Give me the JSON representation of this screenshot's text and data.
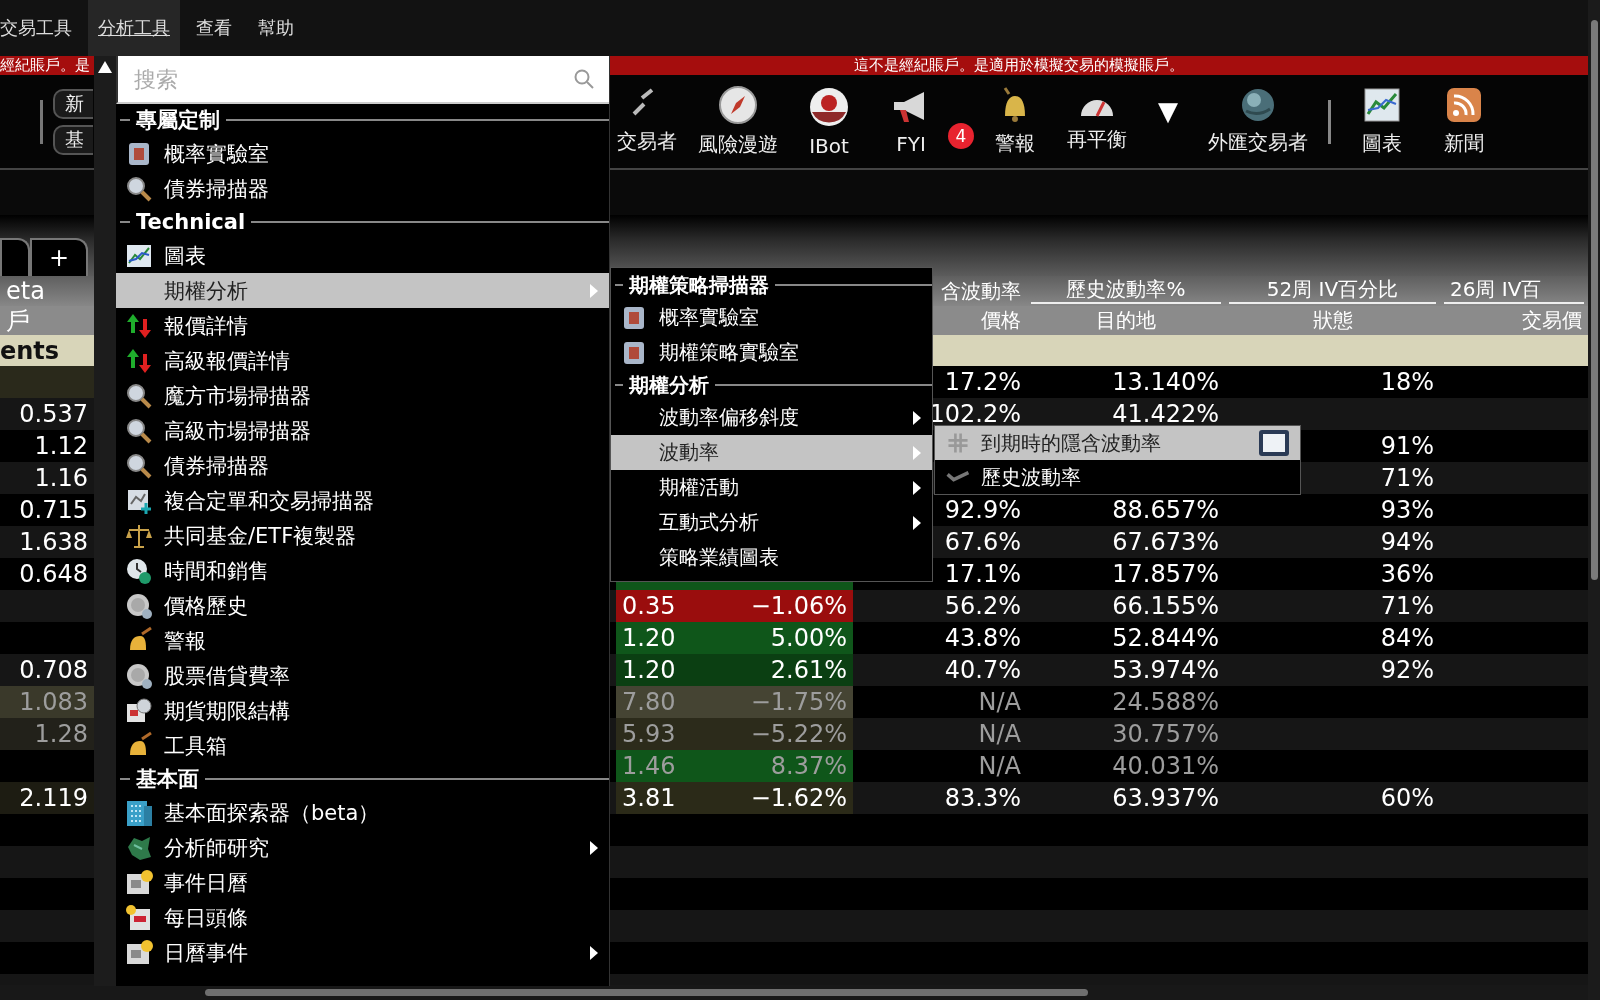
{
  "menu_bar": [
    {
      "label": "交易工具",
      "selected": false
    },
    {
      "label": "分析工具",
      "selected": true
    },
    {
      "label": "查看",
      "selected": false
    },
    {
      "label": "幫助",
      "selected": false
    }
  ],
  "banner": {
    "left_text": "經紀賬戶。是",
    "text": "這不是經紀賬戶。是適用於模擬交易的模擬賬戶。"
  },
  "side_buttons": [
    "新",
    "基"
  ],
  "toolbar": [
    {
      "label": "交易者",
      "kind": "chain"
    },
    {
      "label": "風險漫遊",
      "kind": "compass"
    },
    {
      "label": "IBot",
      "kind": "bot"
    },
    {
      "label": "FYI",
      "kind": "megaphone",
      "badge": "4"
    },
    {
      "label": "警報",
      "kind": "bell"
    },
    {
      "label": "再平衡",
      "kind": "gauge"
    },
    {
      "label": "▼",
      "kind": "dropdown"
    },
    {
      "label": "外匯交易者",
      "kind": "fx"
    },
    {
      "kind": "separator"
    },
    {
      "label": "圖表",
      "kind": "chart"
    },
    {
      "label": "新聞",
      "kind": "rss"
    }
  ],
  "side_tabs": [
    {
      "selected": false
    },
    {
      "label": "+",
      "selected": false
    }
  ],
  "table": {
    "header_left": [
      "eta",
      "戶",
      "ents"
    ],
    "columns_row_1": {
      "column_3": "含波動率",
      "column_4": "歷史波動率%",
      "column_5": "52周 IV百分比",
      "column_6": "26周 IV百"
    },
    "columns_row_2": {
      "column_3": "價格",
      "column_4": "目的地",
      "column_5": "狀態",
      "column_6": "交易價"
    },
    "rows": [
      {
        "column_0": {
          "color": "#2a291b"
        },
        "column_3": "17.2%",
        "column_4": "13.140%",
        "column_5": "18%",
        "dim": false
      },
      {
        "column_0": "0.537",
        "column_3": "102.2%",
        "column_4": "41.422%",
        "dim": false
      },
      {
        "column_0": "1.12",
        "column_5": "91%",
        "dim": false
      },
      {
        "column_0": "1.16",
        "column_5": "71%",
        "dim": false
      },
      {
        "column_0": "0.715",
        "column_3": "92.9%",
        "column_4": "88.657%",
        "column_5": "93%",
        "dim": false
      },
      {
        "column_0": "1.638",
        "column_3": "67.6%",
        "column_4": "67.673%",
        "column_5": "94%",
        "dim": false
      },
      {
        "column_0": "0.648",
        "column_1": {
          "color": "#0f561a"
        },
        "column_2": {
          "color": "#0f561a"
        },
        "column_3": "17.1%",
        "column_4": "17.857%",
        "column_5": "36%",
        "dim": false
      },
      {
        "column_1": {
          "text": "0.35",
          "color": "#9a0d0d"
        },
        "column_2": {
          "text": "−1.06%",
          "color": "#9a0d0d"
        },
        "column_3": "56.2%",
        "column_4": "66.155%",
        "column_5": "71%",
        "dim": false
      },
      {
        "column_1": {
          "text": "1.20",
          "color": "#0f561a"
        },
        "column_2": {
          "text": "5.00%",
          "color": "#0f561a"
        },
        "column_3": "43.8%",
        "column_4": "52.844%",
        "column_5": "84%",
        "dim": false
      },
      {
        "column_0": "0.708",
        "column_1": {
          "text": "1.20",
          "color": "#0b3f12"
        },
        "column_2": {
          "text": "2.61%",
          "color": "#0b3f12"
        },
        "column_3": "40.7%",
        "column_4": "53.974%",
        "column_5": "92%",
        "dim": false
      },
      {
        "column_0": {
          "text": "1.083",
          "color": "#3a392a"
        },
        "column_1": {
          "text": "7.80",
          "color": "#454433"
        },
        "column_2": {
          "text": "−1.75%",
          "color": "#454433"
        },
        "column_3": "N/A",
        "column_4": "24.588%",
        "dim": true
      },
      {
        "column_0": {
          "text": "1.28",
          "color": "#22211a"
        },
        "column_1": {
          "text": "5.93",
          "color": "#2c2b1b"
        },
        "column_2": {
          "text": "−5.22%",
          "color": "#2c2b1b"
        },
        "column_3": "N/A",
        "column_4": "30.757%",
        "dim": true
      },
      {
        "column_1": {
          "text": "1.46",
          "color": "#0f561a"
        },
        "column_2": {
          "text": "8.37%",
          "color": "#0f561a"
        },
        "column_3": "N/A",
        "column_4": "40.031%",
        "dim": true
      },
      {
        "column_0": {
          "text": "2.119",
          "color": "#1d1c12"
        },
        "column_1": {
          "text": "3.81",
          "color": "#2b2a18"
        },
        "column_2": {
          "text": "−1.62%",
          "color": "#2b2a18"
        },
        "column_3": "83.3%",
        "column_4": "63.937%",
        "column_5": "60%",
        "dim": false
      }
    ]
  },
  "dropdown": {
    "search": {
      "placeholder": "搜索"
    },
    "sections": [
      {
        "title": "專屬定制",
        "items": [
          {
            "label": "概率實驗室",
            "kind": "lab",
            "selected": false,
            "submenu": false
          },
          {
            "label": "債券掃描器",
            "kind": "scanner",
            "selected": false,
            "submenu": false
          }
        ]
      },
      {
        "title": "Technical",
        "items": [
          {
            "label": "圖表",
            "kind": "chart",
            "selected": false,
            "submenu": false
          },
          {
            "label": "期權分析",
            "kind": "plain",
            "selected": true,
            "submenu": true
          },
          {
            "label": "報價詳情",
            "kind": "quote",
            "selected": false,
            "submenu": false
          },
          {
            "label": "高級報價詳情",
            "kind": "quote",
            "selected": false,
            "submenu": false
          },
          {
            "label": "魔方市場掃描器",
            "kind": "scanner",
            "selected": false,
            "submenu": false
          },
          {
            "label": "高級市場掃描器",
            "kind": "scanner",
            "selected": false,
            "submenu": false
          },
          {
            "label": "債券掃描器",
            "kind": "scanner",
            "selected": false,
            "submenu": false
          },
          {
            "label": "複合定單和交易掃描器",
            "kind": "combo",
            "selected": false,
            "submenu": false
          },
          {
            "label": "共同基金/ETF複製器",
            "kind": "fund",
            "selected": false,
            "submenu": false
          },
          {
            "label": "時間和銷售",
            "kind": "trades",
            "selected": false,
            "submenu": false
          },
          {
            "label": "價格歷史",
            "kind": "history",
            "selected": false,
            "submenu": false
          },
          {
            "label": "警報",
            "kind": "alert",
            "selected": false,
            "submenu": false
          },
          {
            "label": "股票借貸費率",
            "kind": "history",
            "selected": false,
            "submenu": false
          },
          {
            "label": "期貨期限結構",
            "kind": "futures",
            "selected": false,
            "submenu": false
          },
          {
            "label": "工具箱",
            "kind": "alert",
            "selected": false,
            "submenu": false
          }
        ]
      },
      {
        "title": "基本面",
        "items": [
          {
            "label": "基本面探索器（beta）",
            "kind": "fundamentals",
            "selected": false,
            "submenu": false
          },
          {
            "label": "分析師研究",
            "kind": "research",
            "selected": false,
            "submenu": true
          },
          {
            "label": "事件日曆",
            "kind": "calendar",
            "selected": false,
            "submenu": false
          },
          {
            "label": "每日頭條",
            "kind": "news",
            "selected": false,
            "submenu": false
          },
          {
            "label": "日曆事件",
            "kind": "calendar",
            "selected": false,
            "submenu": true
          }
        ]
      }
    ]
  },
  "options_menu": {
    "sections": [
      {
        "title": "期權策略掃描器",
        "items": [
          {
            "label": "概率實驗室",
            "kind": "lab",
            "selected": false,
            "submenu": false
          },
          {
            "label": "期權策略實驗室",
            "kind": "lab",
            "selected": false,
            "submenu": false
          }
        ]
      },
      {
        "title": "期權分析",
        "items": [
          {
            "label": "波動率偏移斜度",
            "kind": "plain",
            "selected": false,
            "submenu": true
          },
          {
            "label": "波動率",
            "kind": "plain",
            "selected": true,
            "submenu": true
          },
          {
            "label": "期權活動",
            "kind": "plain",
            "selected": false,
            "submenu": true
          },
          {
            "label": "互動式分析",
            "kind": "plain",
            "selected": false,
            "submenu": true
          },
          {
            "label": "策略業績圖表",
            "kind": "plain",
            "selected": false,
            "submenu": false
          }
        ]
      }
    ]
  },
  "volatility_menu": [
    {
      "label": "到期時的隱含波動率",
      "kind": "implied",
      "selected": true,
      "window_button": true
    },
    {
      "label": "歷史波動率",
      "kind": "historical",
      "selected": false,
      "window_button": false
    }
  ]
}
